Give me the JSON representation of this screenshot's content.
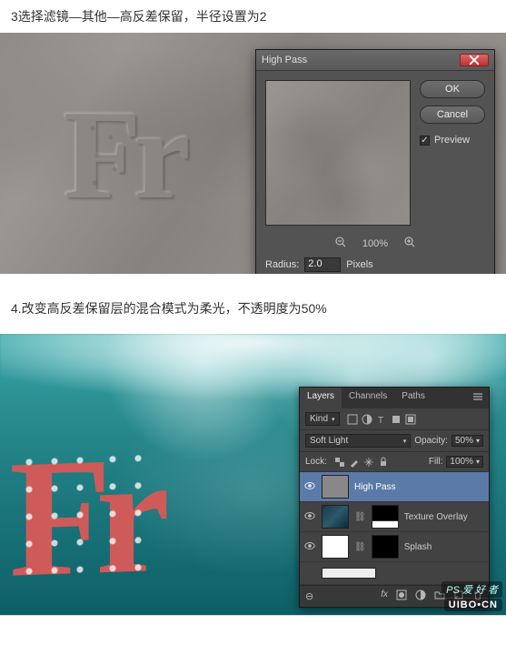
{
  "step3": {
    "text": "3选择滤镜—其他—高反差保留，半径设置为2"
  },
  "step4": {
    "text": "4.改变高反差保留层的混合模式为柔光，不透明度为50%"
  },
  "highpass": {
    "title": "High Pass",
    "ok": "OK",
    "cancel": "Cancel",
    "preview_label": "Preview",
    "preview_checked": true,
    "zoom": "100%",
    "radius_label": "Radius:",
    "radius_value": "2.0",
    "radius_unit": "Pixels"
  },
  "ocean_text": "Fr",
  "layers": {
    "tabs": {
      "layers": "Layers",
      "channels": "Channels",
      "paths": "Paths"
    },
    "kind_label": "Kind",
    "blend_mode": "Soft Light",
    "opacity_label": "Opacity:",
    "opacity_value": "50%",
    "lock_label": "Lock:",
    "fill_label": "Fill:",
    "fill_value": "100%",
    "items": [
      {
        "name": "High Pass"
      },
      {
        "name": "Texture Overlay"
      },
      {
        "name": "Splash"
      }
    ]
  },
  "watermark": {
    "line1": "PS 爱 好 者",
    "line2": "UIBO•CN"
  }
}
